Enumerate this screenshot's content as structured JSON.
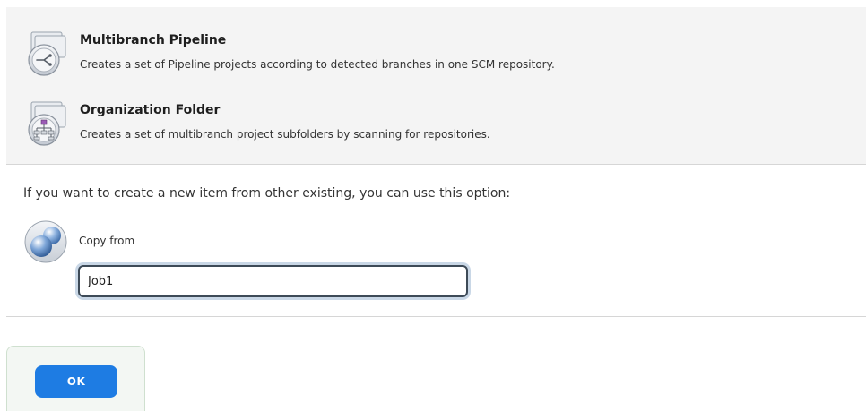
{
  "item_types": [
    {
      "title": "Multibranch Pipeline",
      "description": "Creates a set of Pipeline projects according to detected branches in one SCM repository.",
      "icon": "multibranch-pipeline-icon"
    },
    {
      "title": "Organization Folder",
      "description": "Creates a set of multibranch project subfolders by scanning for repositories.",
      "icon": "organization-folder-icon"
    }
  ],
  "copy": {
    "hint": "If you want to create a new item from other existing, you can use this option:",
    "label": "Copy from",
    "value": "Job1",
    "icon": "copy-item-icon"
  },
  "actions": {
    "ok_label": "OK"
  },
  "colors": {
    "primary_button": "#1e7ce3",
    "panel_background": "#f4f4f4",
    "input_border": "#3d4a57"
  }
}
